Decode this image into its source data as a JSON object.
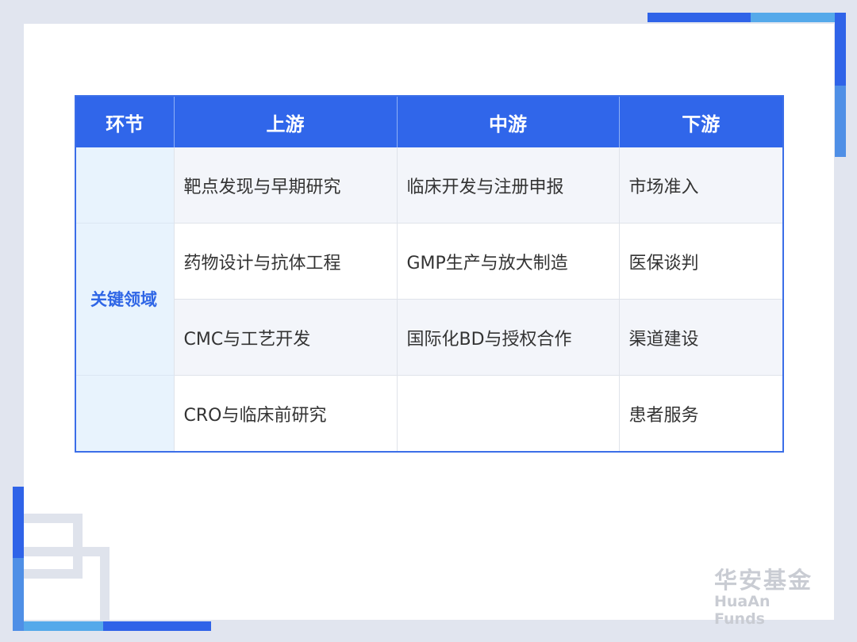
{
  "table": {
    "headers": [
      "环节",
      "上游",
      "中游",
      "下游"
    ],
    "row_label": "关键领域",
    "rows": [
      [
        "靶点发现与早期研究",
        "临床开发与注册申报",
        "市场准入"
      ],
      [
        "药物设计与抗体工程",
        "GMP生产与放大制造",
        "医保谈判"
      ],
      [
        "CMC与工艺开发",
        "国际化BD与授权合作",
        "渠道建设"
      ],
      [
        "CRO与临床前研究",
        "",
        "患者服务"
      ]
    ]
  },
  "logo": {
    "cn": "华安基金",
    "en": "HuaAn Funds"
  },
  "colors": {
    "header_blue": "#3066ea",
    "accent_light_blue": "#55a9ea",
    "label_text": "#2f66e6"
  }
}
